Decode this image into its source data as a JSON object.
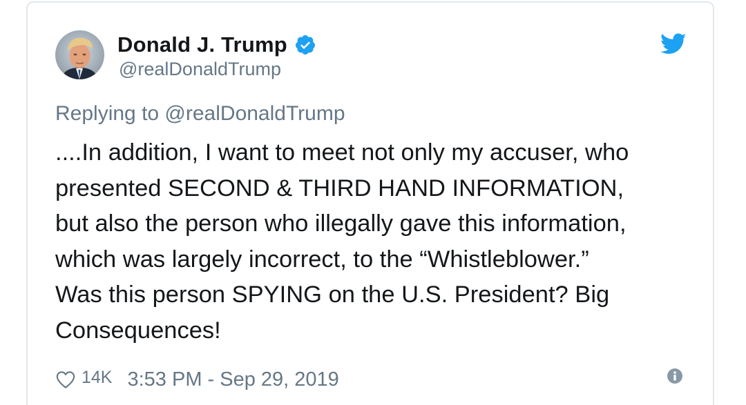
{
  "author": {
    "display_name": "Donald J. Trump",
    "handle": "@realDonaldTrump",
    "verified": true
  },
  "reply": {
    "label": "Replying to @realDonaldTrump"
  },
  "tweet": {
    "text": "....In addition, I want to meet not only my accuser, who\npresented SECOND & THIRD HAND INFORMATION,\nbut also the person who illegally gave this information,\nwhich was largely incorrect, to the “Whistleblower.”\nWas this person SPYING on the U.S. President? Big\nConsequences!"
  },
  "footer": {
    "like_count": "14K",
    "timestamp": "3:53 PM - Sep 29, 2019"
  },
  "icons": {
    "verified": "verified-badge-icon",
    "brand": "twitter-bird-icon",
    "like": "heart-icon",
    "info": "info-icon"
  },
  "colors": {
    "brand_blue": "#1da1f2",
    "text_primary": "#14171a",
    "text_secondary": "#657786",
    "border": "#e1e8ed"
  }
}
